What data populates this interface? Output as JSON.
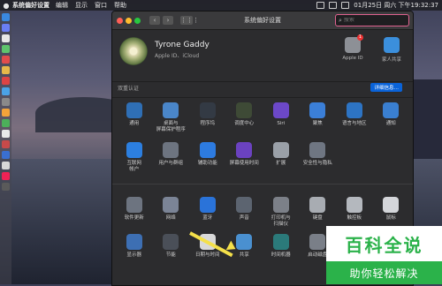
{
  "menubar": {
    "apple_icon": "apple-logo",
    "app_name": "系统偏好设置",
    "menus": [
      "编辑",
      "显示",
      "窗口",
      "帮助"
    ],
    "datetime": "01月25日 周六 下午19:32:37"
  },
  "window": {
    "title": "系统偏好设置",
    "back": "‹",
    "forward": "›",
    "grid_icon": "⋮⋮⋮",
    "search_placeholder": "搜索"
  },
  "account": {
    "name": "Tyrone Gaddy",
    "subtitle": "Apple ID、iCloud",
    "apple_id_label": "Apple ID",
    "apple_id_badge": "1",
    "family_label": "家人共享"
  },
  "notice": {
    "text": "双重认证",
    "button": "详细信息…"
  },
  "rows": [
    [
      {
        "label": "通用",
        "icon": "general-icon",
        "color": "#2f6fb5"
      },
      {
        "label": "桌面与\n屏幕保护程序",
        "icon": "desktop-icon",
        "color": "#4a86c9"
      },
      {
        "label": "程序坞",
        "icon": "dock-icon",
        "color": "#333a44"
      },
      {
        "label": "调度中心",
        "icon": "mission-control-icon",
        "color": "#3e4a36"
      },
      {
        "label": "Siri",
        "icon": "siri-icon",
        "color": "#6c48c8"
      },
      {
        "label": "聚焦",
        "icon": "spotlight-icon",
        "color": "#3b7fd8"
      },
      {
        "label": "语言与地区",
        "icon": "language-icon",
        "color": "#2d74c4"
      },
      {
        "label": "通知",
        "icon": "notifications-icon",
        "color": "#3a7fd0"
      }
    ],
    [
      {
        "label": "互联网\n帐户",
        "icon": "internet-accounts-icon",
        "color": "#2c7fe0"
      },
      {
        "label": "用户与群组",
        "icon": "users-icon",
        "color": "#6d7480"
      },
      {
        "label": "辅助功能",
        "icon": "accessibility-icon",
        "color": "#2d7be0"
      },
      {
        "label": "屏幕使用时间",
        "icon": "screen-time-icon",
        "color": "#6b42c0"
      },
      {
        "label": "扩展",
        "icon": "extensions-icon",
        "color": "#9aa0a8"
      },
      {
        "label": "安全性与隐私",
        "icon": "security-icon",
        "color": "#6f7682"
      }
    ],
    [
      {
        "label": "软件更新",
        "icon": "software-update-icon",
        "color": "#6d7480"
      },
      {
        "label": "网络",
        "icon": "network-icon",
        "color": "#7b8496"
      },
      {
        "label": "蓝牙",
        "icon": "bluetooth-icon",
        "color": "#2a73d9"
      },
      {
        "label": "声音",
        "icon": "sound-icon",
        "color": "#5c6470"
      },
      {
        "label": "打印机与\n扫描仪",
        "icon": "printer-icon",
        "color": "#7c8088"
      },
      {
        "label": "键盘",
        "icon": "keyboard-icon",
        "color": "#a8acb2"
      },
      {
        "label": "触控板",
        "icon": "trackpad-icon",
        "color": "#b4b8be"
      },
      {
        "label": "鼠标",
        "icon": "mouse-icon",
        "color": "#d4d6da"
      }
    ],
    [
      {
        "label": "显示器",
        "icon": "displays-icon",
        "color": "#3d6fb3"
      },
      {
        "label": "节能",
        "icon": "energy-saver-icon",
        "color": "#4a4f58"
      },
      {
        "label": "日期与时间",
        "icon": "date-time-icon",
        "color": "#d9d9d9"
      },
      {
        "label": "共享",
        "icon": "sharing-icon",
        "color": "#4a90d0"
      },
      {
        "label": "时间机器",
        "icon": "time-machine-icon",
        "color": "#2b7a7a"
      },
      {
        "label": "启动磁盘",
        "icon": "startup-disk-icon",
        "color": "#7a7f88"
      }
    ]
  ],
  "watermark": {
    "title": "百科全说",
    "subtitle": "助你轻松解决"
  }
}
